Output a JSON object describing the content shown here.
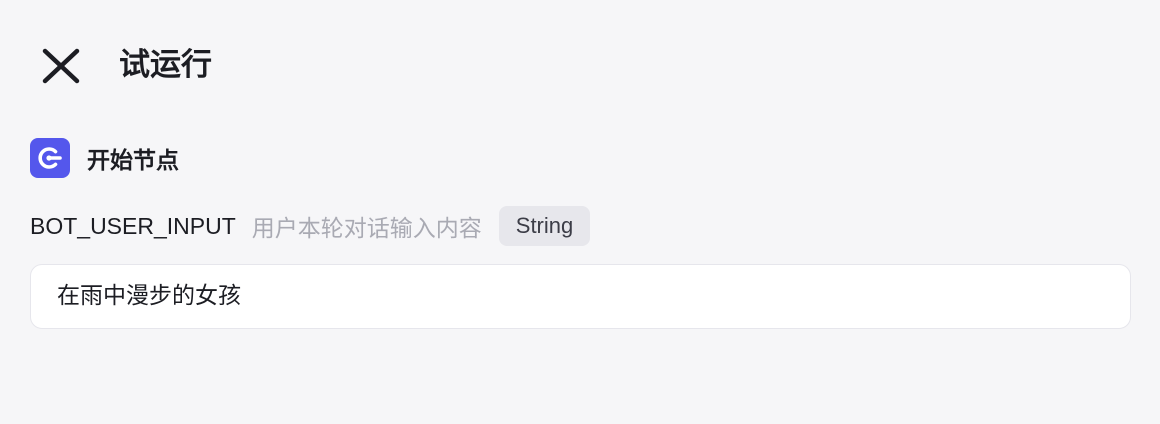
{
  "header": {
    "title": "试运行",
    "close_icon": "close-icon"
  },
  "node": {
    "icon": "start-node-icon",
    "icon_color": "#5457ec",
    "title": "开始节点"
  },
  "param": {
    "name": "BOT_USER_INPUT",
    "description": "用户本轮对话输入内容",
    "type": "String"
  },
  "input": {
    "value": "在雨中漫步的女孩"
  }
}
